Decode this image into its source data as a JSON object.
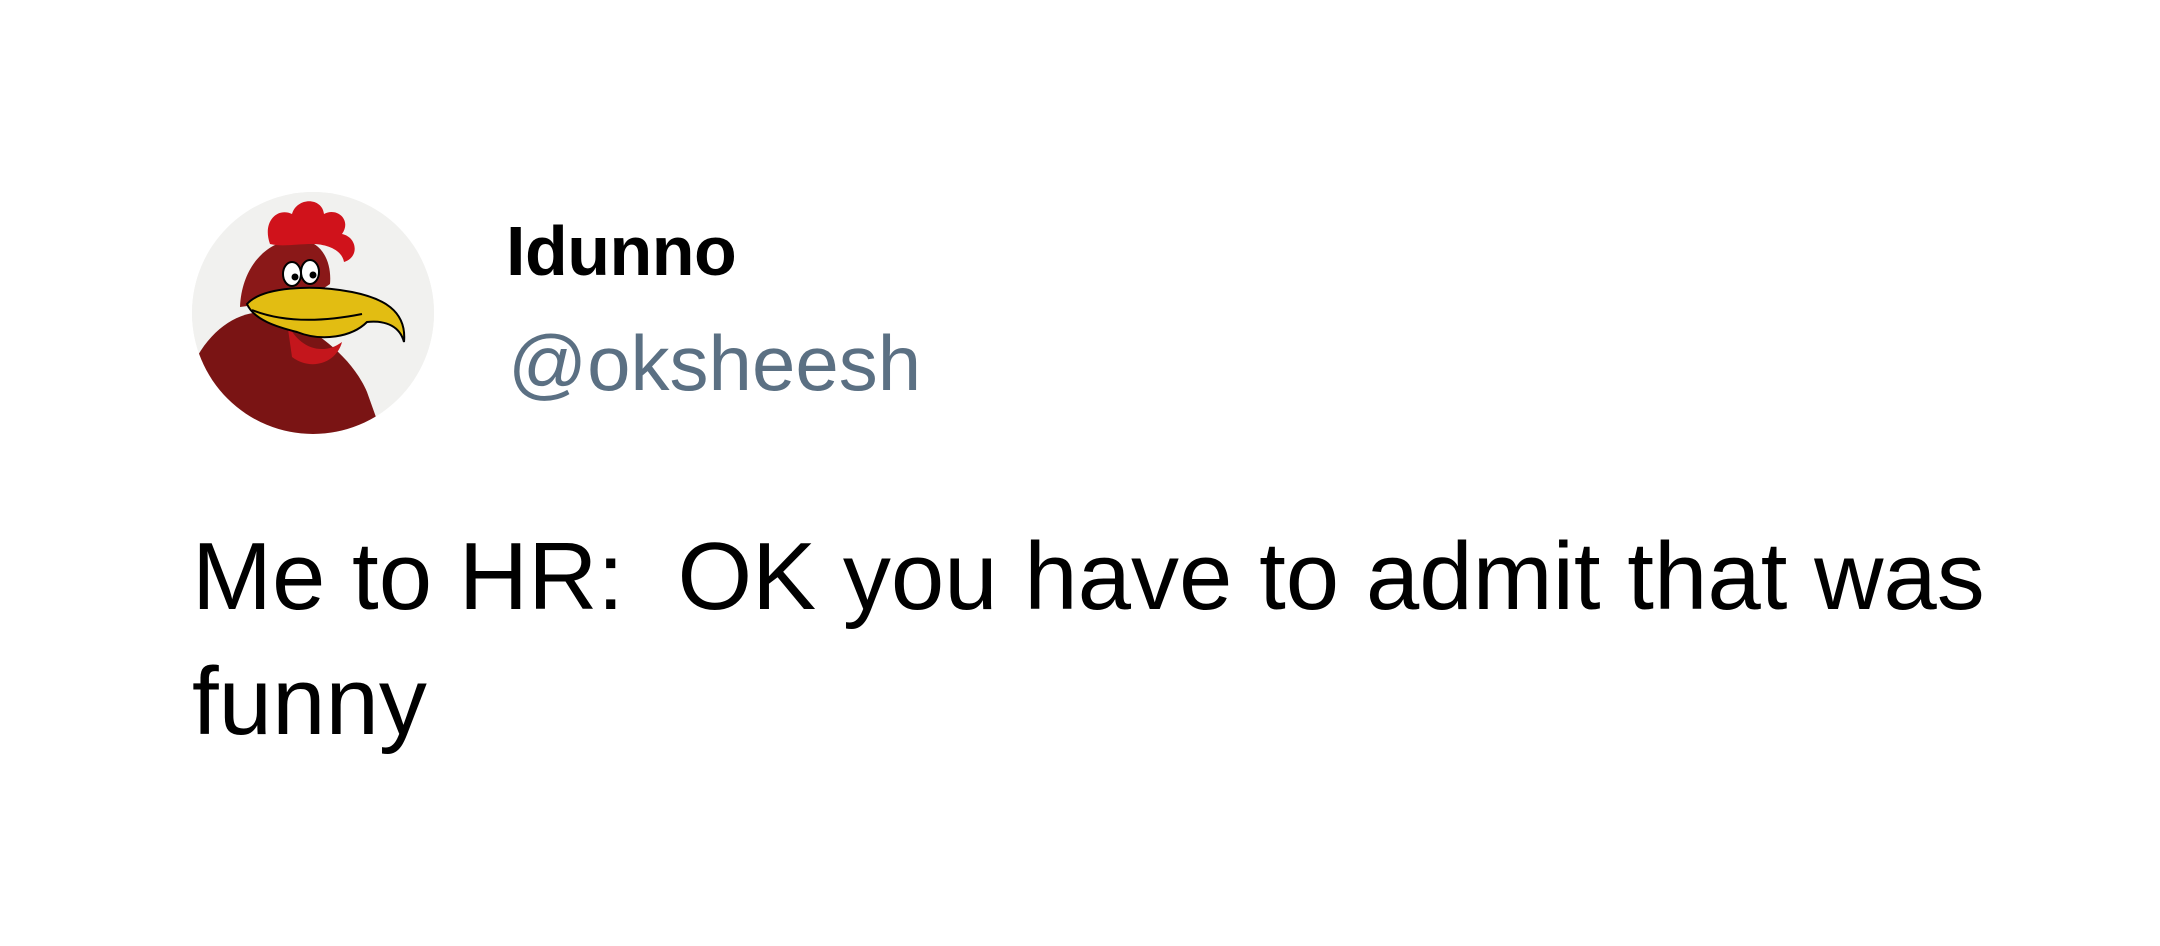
{
  "tweet": {
    "author": {
      "display_name": "Idunno",
      "handle": "@oksheesh",
      "avatar_icon": "rooster-avatar-icon"
    },
    "text": "Me to HR:  OK you have to admit that was funny"
  },
  "colors": {
    "background": "#ffffff",
    "name_text": "#000000",
    "handle_text": "#5b7083",
    "body_text": "#000000",
    "comb_red": "#d0121b",
    "beak_yellow": "#e2bd12",
    "body_maroon": "#7a1414"
  }
}
